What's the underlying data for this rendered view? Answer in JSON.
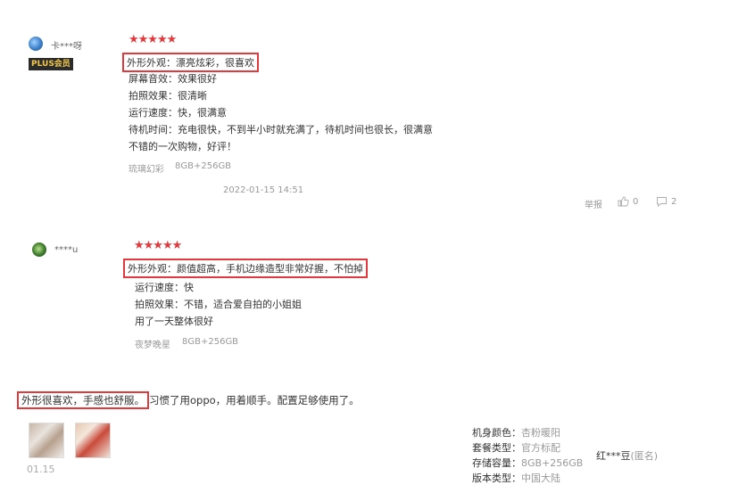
{
  "reviews": [
    {
      "username": "卡***呀",
      "badge": "PLUS会员",
      "stars": "★★★★★",
      "lines": [
        "外形外观：漂亮炫彩，很喜欢",
        "屏幕音效：效果很好",
        "拍照效果：很清晰",
        "运行速度：快，很满意",
        "待机时间：充电很快，不到半小时就充满了，待机时间也很长，很满意",
        "不错的一次购物，好评！"
      ],
      "variant_color": "琉璃幻彩",
      "variant_storage": "8GB+256GB",
      "date": "2022-01-15 14:51",
      "report": "举报",
      "likes": "0",
      "comments": "2"
    },
    {
      "username": "****u",
      "stars": "★★★★★",
      "lines": [
        "外形外观：颜值超高，手机边缘造型非常好握，不怕掉",
        "运行速度：快",
        "拍照效果：不错，适合爱自拍的小姐姐",
        "用了一天整体很好"
      ],
      "variant_color": "夜梦晚星",
      "variant_storage": "8GB+256GB"
    },
    {
      "text_highlight": "外形很喜欢，手感也舒服。",
      "text_rest": "习惯了用oppo，用着顺手。配置足够使用了。",
      "date": "01.15",
      "specs": [
        {
          "key": "机身颜色：",
          "value": "杏粉暖阳"
        },
        {
          "key": "套餐类型：",
          "value": "官方标配"
        },
        {
          "key": "存储容量：",
          "value": "8GB+256GB"
        },
        {
          "key": "版本类型：",
          "value": "中国大陆"
        }
      ],
      "reviewer": "红***豆",
      "anonymous": "(匿名)"
    }
  ],
  "colors": {
    "accent_red": "#e4393c",
    "muted": "#999999"
  },
  "icons": {
    "like": "thumb-up-icon",
    "comment": "comment-icon"
  }
}
